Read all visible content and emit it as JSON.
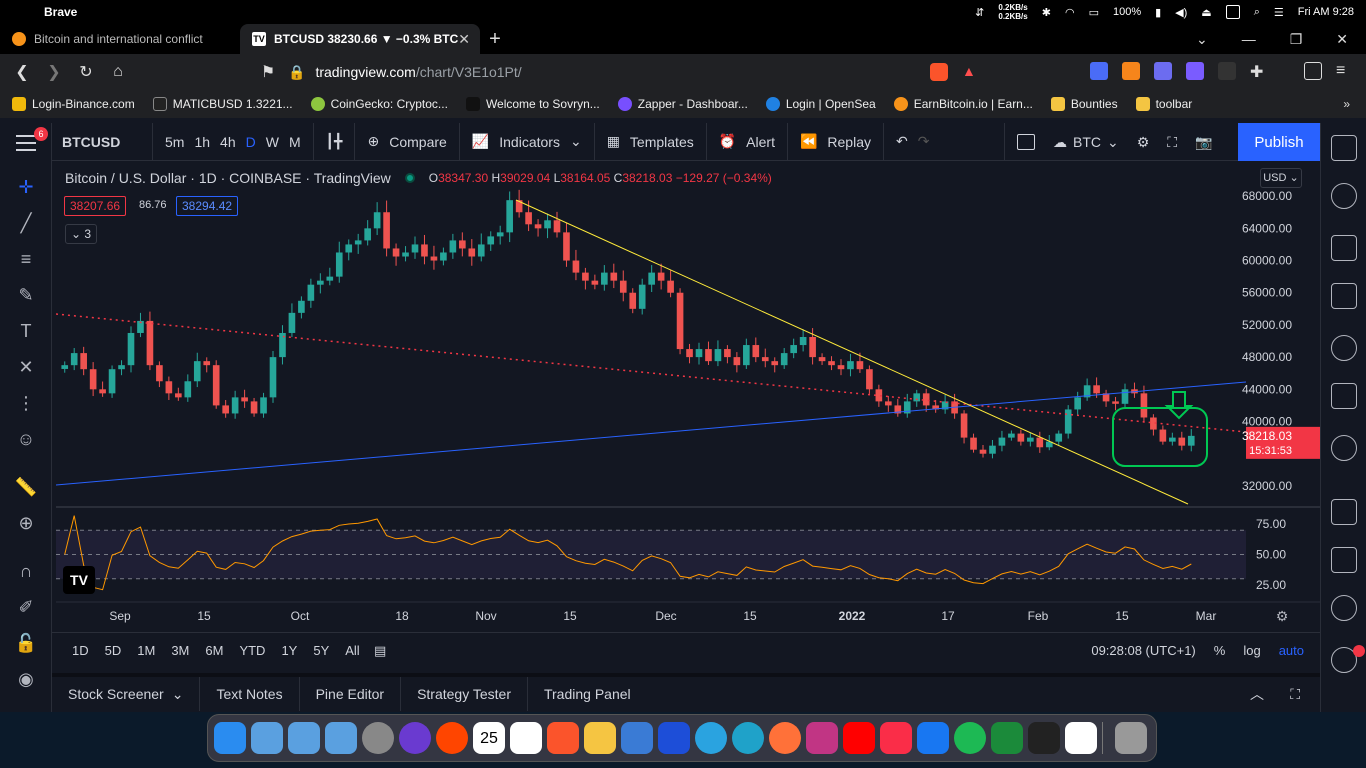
{
  "mac_menu": {
    "app_name": "Brave",
    "net_up": "0.2KB/s",
    "net_down": "0.2KB/s",
    "battery": "100%",
    "clock": "Fri AM 9:28"
  },
  "browser": {
    "tabs": [
      {
        "title": "Bitcoin and international conflict",
        "active": false
      },
      {
        "title": "BTCUSD 38230.66 ▼ −0.3% BTC",
        "active": true
      }
    ],
    "url_host": "tradingview.com",
    "url_path": "/chart/V3E1o1Pt/",
    "bookmarks": [
      "Login-Binance.com",
      "MATICBUSD 1.3221...",
      "CoinGecko: Cryptoc...",
      "Welcome to Sovryn...",
      "Zapper - Dashboar...",
      "Login | OpenSea",
      "EarnBitcoin.io | Earn...",
      "Bounties",
      "toolbar"
    ]
  },
  "toolbar": {
    "symbol": "BTCUSD",
    "intervals": [
      "5m",
      "1h",
      "4h",
      "D",
      "W",
      "M"
    ],
    "active_interval": "D",
    "compare": "Compare",
    "indicators": "Indicators",
    "templates": "Templates",
    "alert": "Alert",
    "replay": "Replay",
    "currency": "BTC",
    "publish": "Publish"
  },
  "left_badge": "6",
  "legend": {
    "title": "Bitcoin / U.S. Dollar · 1D · COINBASE · TradingView",
    "o_label": "O",
    "o": "38347.30",
    "h_label": "H",
    "h": "39029.04",
    "l_label": "L",
    "l": "38164.05",
    "c_label": "C",
    "c": "38218.03",
    "change": "−129.27 (−0.34%)",
    "bid": "38207.66",
    "spread": "86.76",
    "ask": "38294.42",
    "collapsed_count": "3"
  },
  "price_axis": {
    "currency_unit": "USD",
    "ticks": [
      "68000.00",
      "64000.00",
      "60000.00",
      "56000.00",
      "52000.00",
      "48000.00",
      "44000.00",
      "40000.00",
      "32000.00"
    ],
    "last_price": "38218.03",
    "countdown": "15:31:53",
    "rsi_ticks": [
      "75.00",
      "50.00",
      "25.00"
    ]
  },
  "time_axis": [
    "Sep",
    "15",
    "Oct",
    "18",
    "Nov",
    "15",
    "Dec",
    "15",
    "2022",
    "17",
    "Feb",
    "15",
    "Mar"
  ],
  "range_bar": {
    "ranges": [
      "1D",
      "5D",
      "1M",
      "3M",
      "6M",
      "YTD",
      "1Y",
      "5Y",
      "All"
    ],
    "clock": "09:28:08 (UTC+1)",
    "percent": "%",
    "log": "log",
    "auto": "auto"
  },
  "bottom_tabs": [
    "Stock Screener",
    "Text Notes",
    "Pine Editor",
    "Strategy Tester",
    "Trading Panel"
  ],
  "dock_date": "25",
  "chart_data": {
    "type": "candlestick",
    "symbol": "BTCUSD",
    "interval": "1D",
    "exchange": "COINBASE",
    "ylim": [
      30000,
      72000
    ],
    "closes_approx": [
      47000,
      48500,
      46500,
      44000,
      43500,
      46500,
      47000,
      51000,
      52500,
      47000,
      45000,
      43500,
      43000,
      45000,
      47500,
      47000,
      42000,
      41000,
      43000,
      42500,
      41000,
      43000,
      48000,
      51000,
      53500,
      55000,
      57000,
      57500,
      58000,
      61000,
      62000,
      62500,
      64000,
      66000,
      61500,
      60500,
      61000,
      62000,
      60500,
      60000,
      61000,
      62500,
      61500,
      60500,
      62000,
      63000,
      63500,
      67500,
      66000,
      64500,
      64000,
      65000,
      63500,
      60000,
      58500,
      57500,
      57000,
      58500,
      57500,
      56000,
      54000,
      57000,
      58500,
      57500,
      56000,
      49000,
      48000,
      49000,
      47500,
      49000,
      48000,
      47000,
      49500,
      48000,
      47500,
      47000,
      48500,
      49500,
      50500,
      48000,
      47500,
      47000,
      46500,
      47500,
      46500,
      44000,
      42500,
      42000,
      41000,
      42500,
      43500,
      42000,
      41500,
      42500,
      41000,
      38000,
      36500,
      36000,
      37000,
      38000,
      38500,
      37500,
      38000,
      36800,
      37500,
      38500,
      41500,
      43000,
      44500,
      43500,
      42500,
      42200,
      44000,
      43500,
      40500,
      39000,
      37500,
      38000,
      37000,
      38218
    ],
    "rsi_levels": [
      70,
      50,
      30
    ],
    "lines": [
      {
        "kind": "trendline",
        "color": "#ffeb3b"
      },
      {
        "kind": "trendline",
        "color": "#2962ff"
      },
      {
        "kind": "dotted-trendline",
        "color": "#f23645"
      }
    ],
    "annotation": "green-rounded-box-with-down-arrow"
  }
}
